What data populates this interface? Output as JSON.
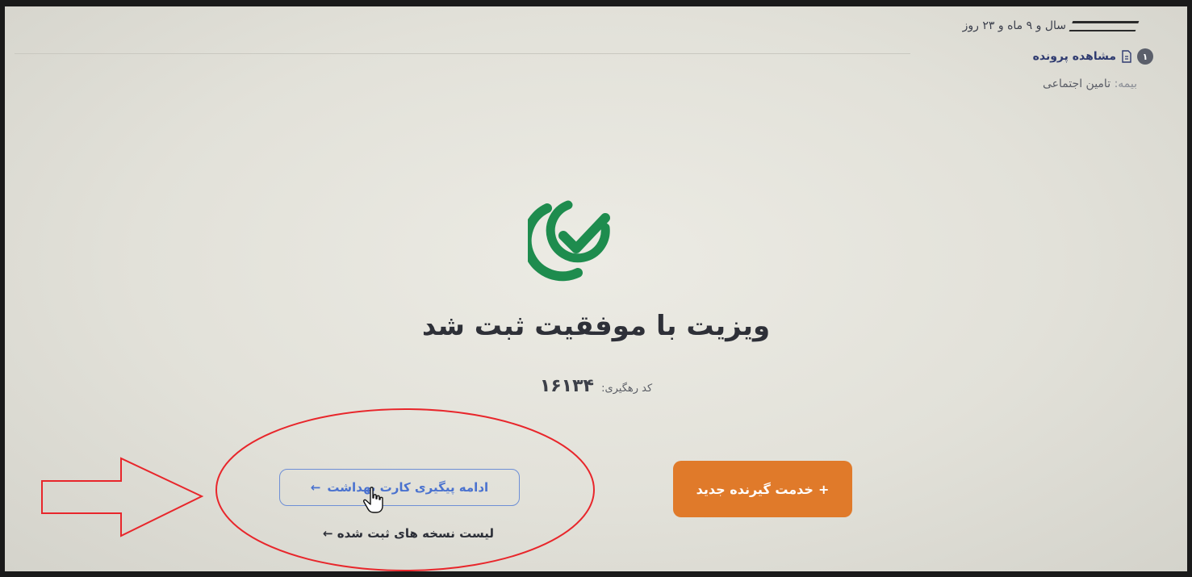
{
  "patient": {
    "age_text": "سال و ۹ ماه و ۲۳ روز",
    "step_number": "۱",
    "view_file_label": "مشاهده پرونده",
    "insurance_label": "بیمه:",
    "insurance_value": "تامین اجتماعی"
  },
  "result": {
    "title": "ویزیت با موفقیت ثبت شد",
    "tracking_label": "کد رهگیری:",
    "tracking_code": "۱۶۱۳۴"
  },
  "actions": {
    "continue_health_card_label": "ادامه پیگیری کارت بهداشت",
    "continue_arrow": "←",
    "new_service_label": "خدمت گیرنده جدید",
    "new_service_plus": "+",
    "registered_list_label": "لیست نسخه های ثبت شده",
    "list_arrow": "←"
  },
  "icons": {
    "success": "check-circle-icon",
    "file": "file-icon",
    "cursor": "hand-pointer-icon"
  },
  "colors": {
    "accent_green": "#1e8c4e",
    "primary_orange": "#e07a2a",
    "outline_blue": "#4a72cf",
    "annotation_red": "#e8262b"
  }
}
